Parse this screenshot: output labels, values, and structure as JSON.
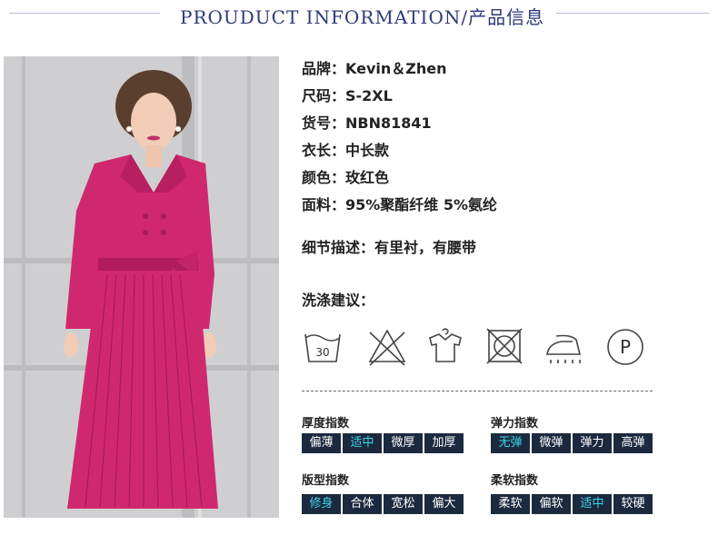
{
  "header": {
    "title": "PROUDUCT INFORMATION/产品信息"
  },
  "info": {
    "brand": "品牌：Kevin＆Zhen",
    "size": "尺码：S-2XL",
    "sku": "货号：NBN81841",
    "length": "衣长：中长款",
    "color": "颜色：玫红色",
    "fabric": "面料：95%聚酯纤维 5%氨纶"
  },
  "detail": "细节描述：有里衬，有腰带",
  "wash": {
    "title": "洗涤建议：",
    "temp": "30",
    "icons": [
      "wash-30-icon",
      "no-bleach-icon",
      "hang-dry-icon",
      "no-tumble-dry-icon",
      "steam-iron-icon",
      "dry-clean-p-icon"
    ],
    "dry_clean_letter": "P"
  },
  "indices": {
    "thickness": {
      "label": "厚度指数",
      "options": [
        "偏薄",
        "适中",
        "微厚",
        "加厚"
      ],
      "selected": 1
    },
    "elasticity": {
      "label": "弹力指数",
      "options": [
        "无弹",
        "微弹",
        "弹力",
        "高弹"
      ],
      "selected": 0
    },
    "fit": {
      "label": "版型指数",
      "options": [
        "修身",
        "合体",
        "宽松",
        "偏大"
      ],
      "selected": 0
    },
    "softness": {
      "label": "柔软指数",
      "options": [
        "柔软",
        "偏软",
        "适中",
        "较硬"
      ],
      "selected": 2
    }
  },
  "colors": {
    "accent": "#3fd3e6",
    "chip_bg": "#1c2a3f",
    "dress": "#d0286f",
    "title": "#2b3a78"
  }
}
